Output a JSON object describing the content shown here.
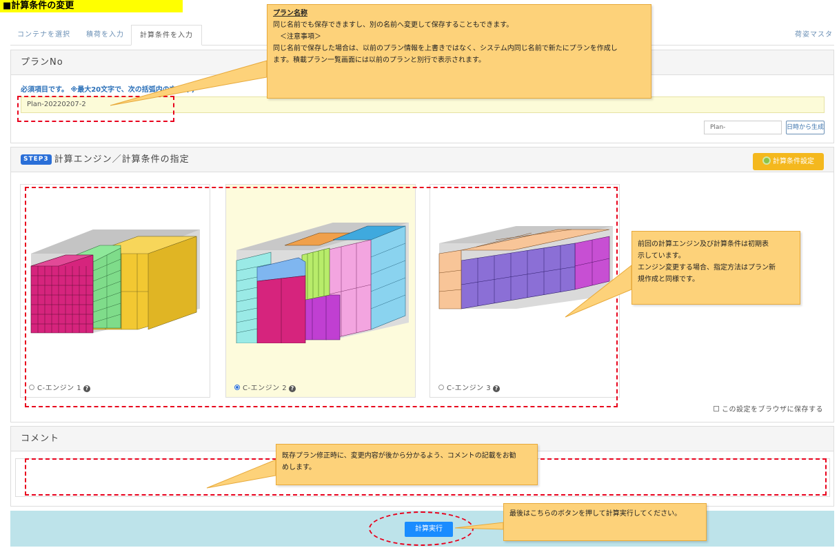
{
  "page_title": "■計算条件の変更",
  "tabs": [
    {
      "label": "コンテナを選択"
    },
    {
      "label": "積荷を入力"
    },
    {
      "label": "計算条件を入力"
    }
  ],
  "tab_right": "荷姿マスタ",
  "plan": {
    "header": "プランNo",
    "note": "必須項目です。 ※最大20文字で、次の括弧内の文字",
    "note_tail": "( )",
    "value": "Plan-20220207-2",
    "prefix_value": "Plan-",
    "generate_label": "日時から生成"
  },
  "engine": {
    "step_badge": "STEP3",
    "header": "計算エンジン／計算条件の指定",
    "settings_label": "計算条件設定",
    "options": [
      {
        "label": "C-エンジン 1",
        "selected": false
      },
      {
        "label": "C-エンジン 2",
        "selected": true
      },
      {
        "label": "C-エンジン 3",
        "selected": false
      }
    ],
    "save_browser_label": "この設定をブラウザに保存する"
  },
  "comment": {
    "header": "コメント",
    "value": ""
  },
  "execute_label": "計算実行",
  "callouts": {
    "plan_name": {
      "title": "プラン名称",
      "line1": "同じ名前でも保存できますし、別の名前へ変更して保存することもできます。",
      "line2": "＜注意事項＞",
      "line3": "同じ名前で保存した場合は、以前のプラン情報を上書きではなく、システム内同じ名前で新たにプランを作成し",
      "line4": "ます。積載プラン一覧画面には以前のプランと別行で表示されます。"
    },
    "engine": {
      "line1": "前回の計算エンジン及び計算条件は初期表",
      "line2": "示しています。",
      "line3": "エンジン変更する場合、指定方法はプラン新",
      "line4": "規作成と同様です。"
    },
    "comment": {
      "line1": "既存プラン修正時に、変更内容が後から分かるよう、コメントの記載をお勧",
      "line2": "めします。"
    },
    "execute": {
      "line1": "最後はこちらのボタンを押して計算実行してください。"
    }
  },
  "colors": {
    "callout_bg": "#fdd27a",
    "highlight_red": "#e8001c",
    "primary_button": "#1a8cff",
    "settings_button": "#f4b81e",
    "exec_bar": "#bde3ea",
    "plan_input_bg": "#fcfbd8"
  }
}
